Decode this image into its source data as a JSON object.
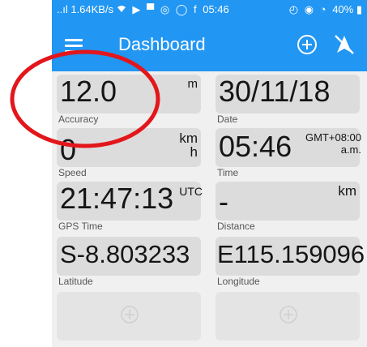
{
  "statusbar": {
    "network": "..ıl 1.64KB/s",
    "time": "05:46",
    "battery": "40%",
    "icons_left": [
      "signal-icon",
      "wifi-icon",
      "cast-icon",
      "message-icon",
      "settings-icon",
      "whatsapp-icon",
      "facebook-icon"
    ],
    "icons_right": [
      "alarm-icon",
      "eye-icon",
      "timer-icon",
      "battery-charging-icon"
    ]
  },
  "appbar": {
    "title": "Dashboard",
    "color": "#2196f3"
  },
  "cards": {
    "accuracy": {
      "value": "12.0",
      "unit": "m",
      "label": "Accuracy"
    },
    "date": {
      "value": "30/11/18",
      "label": "Date"
    },
    "speed": {
      "value": "0",
      "unit_top": "km",
      "unit_bottom": "h",
      "label": "Speed"
    },
    "time": {
      "value": "05:46",
      "unit_top": "GMT+08:00",
      "unit_bottom": "a.m.",
      "label": "Time"
    },
    "gps_time": {
      "value": "21:47:13",
      "unit": "UTC",
      "label": "GPS Time"
    },
    "distance": {
      "value": "-",
      "unit": "km",
      "label": "Distance"
    },
    "latitude": {
      "value": "S-8.803233",
      "label": "Latitude"
    },
    "longitude": {
      "value": "E115.159096",
      "label": "Longitude"
    }
  },
  "annotation": {
    "color": "#e3161b"
  }
}
